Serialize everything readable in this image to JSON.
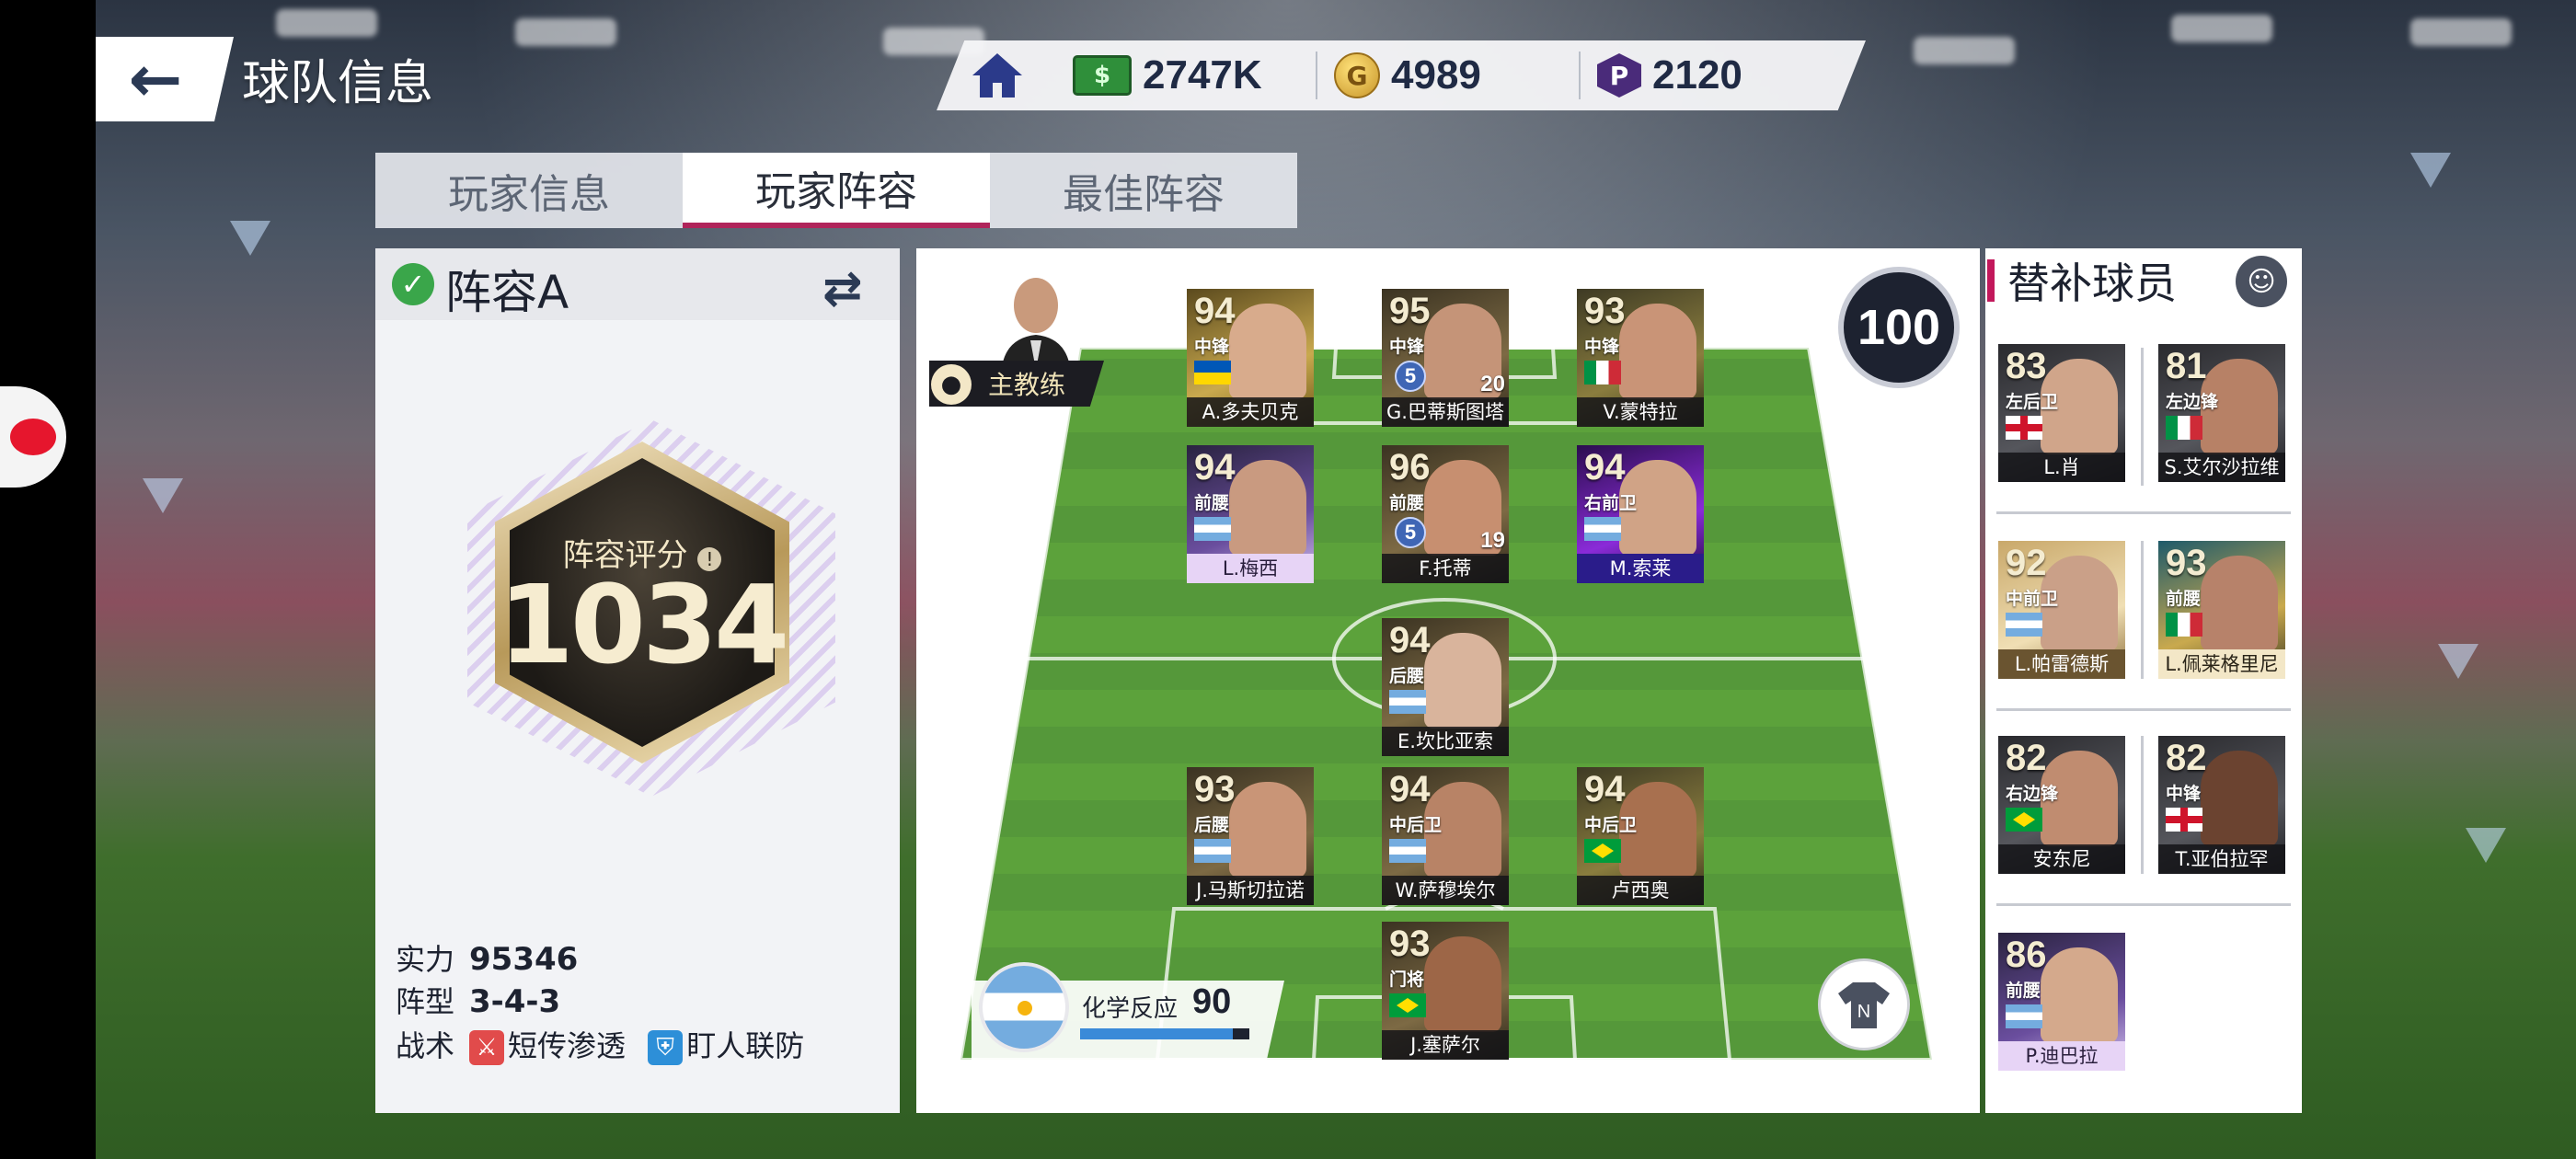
{
  "header": {
    "back_icon": "arrow-left-icon",
    "title": "球队信息",
    "home_icon": "home-icon",
    "cash": "2747K",
    "gold": "4989",
    "gold_symbol": "G",
    "points": "2120",
    "points_symbol": "P"
  },
  "tabs": [
    {
      "label": "玩家信息",
      "active": false
    },
    {
      "label": "玩家阵容",
      "active": true
    },
    {
      "label": "最佳阵容",
      "active": false
    }
  ],
  "lineup": {
    "name": "阵容A",
    "badge_label": "阵容评分",
    "badge_score": "1034",
    "stats": {
      "strength_label": "实力",
      "strength": "95346",
      "formation_label": "阵型",
      "formation": "3-4-3",
      "tactics_label": "战术",
      "tactic_1": "短传渗透",
      "tactic_2": "盯人联防"
    }
  },
  "pitch": {
    "coach_label": "主教练",
    "team_ovr": "100",
    "chemistry_label": "化学反应",
    "chemistry_value": "90",
    "kit_label": "N",
    "players": [
      {
        "rating": "94",
        "pos": "中锋",
        "name": "A.多夫贝克",
        "extra": ""
      },
      {
        "rating": "95",
        "pos": "中锋",
        "name": "G.巴蒂斯图塔",
        "extra": "20",
        "star": "5"
      },
      {
        "rating": "93",
        "pos": "中锋",
        "name": "V.蒙特拉",
        "extra": ""
      },
      {
        "rating": "94",
        "pos": "前腰",
        "name": "L.梅西",
        "extra": ""
      },
      {
        "rating": "96",
        "pos": "前腰",
        "name": "F.托蒂",
        "extra": "19",
        "star": "5"
      },
      {
        "rating": "94",
        "pos": "右前卫",
        "name": "M.索莱",
        "extra": ""
      },
      {
        "rating": "94",
        "pos": "后腰",
        "name": "E.坎比亚索",
        "extra": ""
      },
      {
        "rating": "93",
        "pos": "后腰",
        "name": "J.马斯切拉诺",
        "extra": ""
      },
      {
        "rating": "94",
        "pos": "中后卫",
        "name": "W.萨穆埃尔",
        "extra": ""
      },
      {
        "rating": "94",
        "pos": "中后卫",
        "name": "卢西奥",
        "extra": ""
      },
      {
        "rating": "93",
        "pos": "门将",
        "name": "J.塞萨尔",
        "extra": ""
      }
    ]
  },
  "subs": {
    "title": "替补球员",
    "players": [
      {
        "rating": "83",
        "pos": "左后卫",
        "name": "L.肖"
      },
      {
        "rating": "81",
        "pos": "左边锋",
        "name": "S.艾尔沙拉维"
      },
      {
        "rating": "92",
        "pos": "中前卫",
        "name": "L.帕雷德斯"
      },
      {
        "rating": "93",
        "pos": "前腰",
        "name": "L.佩莱格里尼"
      },
      {
        "rating": "82",
        "pos": "右边锋",
        "name": "安东尼"
      },
      {
        "rating": "82",
        "pos": "中锋",
        "name": "T.亚伯拉罕"
      },
      {
        "rating": "86",
        "pos": "前腰",
        "name": "P.迪巴拉"
      }
    ]
  },
  "colors": {
    "tab_active_underline": "#b0245a",
    "pitch_green": "#5aa03a",
    "accent_pink": "#c2185b"
  }
}
